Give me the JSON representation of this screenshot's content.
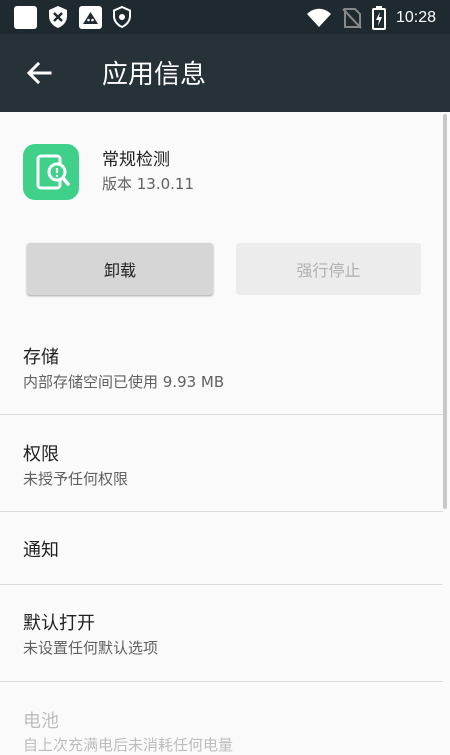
{
  "status_bar": {
    "time": "10:28",
    "icons": [
      "notification-square-icon",
      "shield-x-icon",
      "app-notification-icon",
      "shield-icon",
      "wifi-icon",
      "no-sim-icon",
      "battery-charging-icon"
    ]
  },
  "app_bar": {
    "title": "应用信息",
    "back_icon": "arrow-left-icon"
  },
  "app": {
    "name": "常规检测",
    "version": "版本 13.0.11",
    "icon": "phone-search-icon",
    "icon_color": "#3fd18a"
  },
  "buttons": {
    "uninstall": "卸载",
    "force_stop": "强行停止"
  },
  "items": [
    {
      "title": "存储",
      "subtitle": "内部存储空间已使用 9.93 MB"
    },
    {
      "title": "权限",
      "subtitle": "未授予任何权限"
    },
    {
      "title": "通知",
      "subtitle": ""
    },
    {
      "title": "默认打开",
      "subtitle": "未设置任何默认选项"
    },
    {
      "title": "电池",
      "subtitle": "自上次充满电后未消耗任何电量"
    }
  ],
  "colors": {
    "appbar": "#263238",
    "statusbar": "#1f2a30",
    "background": "#fafafa"
  }
}
